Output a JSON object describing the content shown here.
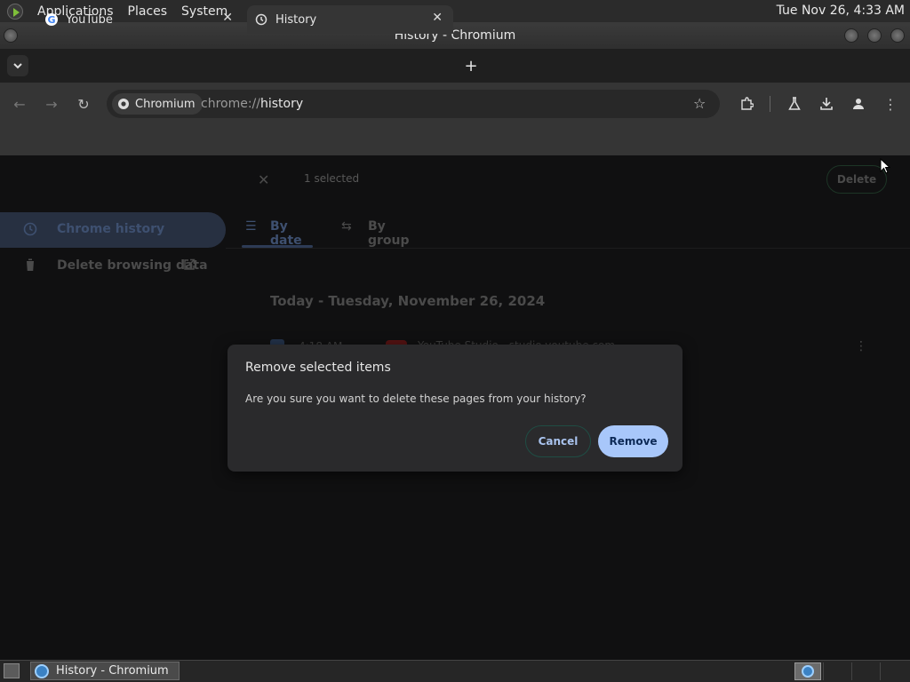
{
  "system_panel": {
    "menus": [
      "Applications",
      "Places",
      "System"
    ],
    "clock": "Tue Nov 26,  4:33 AM"
  },
  "window": {
    "title": "History - Chromium"
  },
  "tabs": [
    {
      "label": "YouTube",
      "icon": "google-icon",
      "active": false
    },
    {
      "label": "History",
      "icon": "history-icon",
      "active": true
    }
  ],
  "toolbar": {
    "site_chip": "Chromium",
    "url_prefix": "chrome://",
    "url_path": "history"
  },
  "history_page": {
    "selection": {
      "count_text": "1 selected",
      "delete_label": "Delete"
    },
    "sidebar": [
      {
        "label": "Chrome history",
        "icon": "history-icon",
        "active": true
      },
      {
        "label": "Delete browsing data",
        "icon": "trash-icon",
        "active": false
      }
    ],
    "view_tabs": [
      {
        "label": "By date",
        "active": true
      },
      {
        "label": "By group",
        "active": false
      }
    ],
    "day_heading": "Today - Tuesday, November 26, 2024",
    "rows": [
      {
        "time": "4:18 AM",
        "title": "YouTube Studio - studio.youtube.com"
      }
    ]
  },
  "dialog": {
    "title": "Remove selected items",
    "body": "Are you sure you want to delete these pages from your history?",
    "cancel_label": "Cancel",
    "remove_label": "Remove"
  },
  "taskbar": {
    "task_label": "History - Chromium"
  },
  "colors": {
    "accent": "#a8c7fa",
    "dialog_bg": "#2a2a2c",
    "page_bg": "#101011"
  }
}
